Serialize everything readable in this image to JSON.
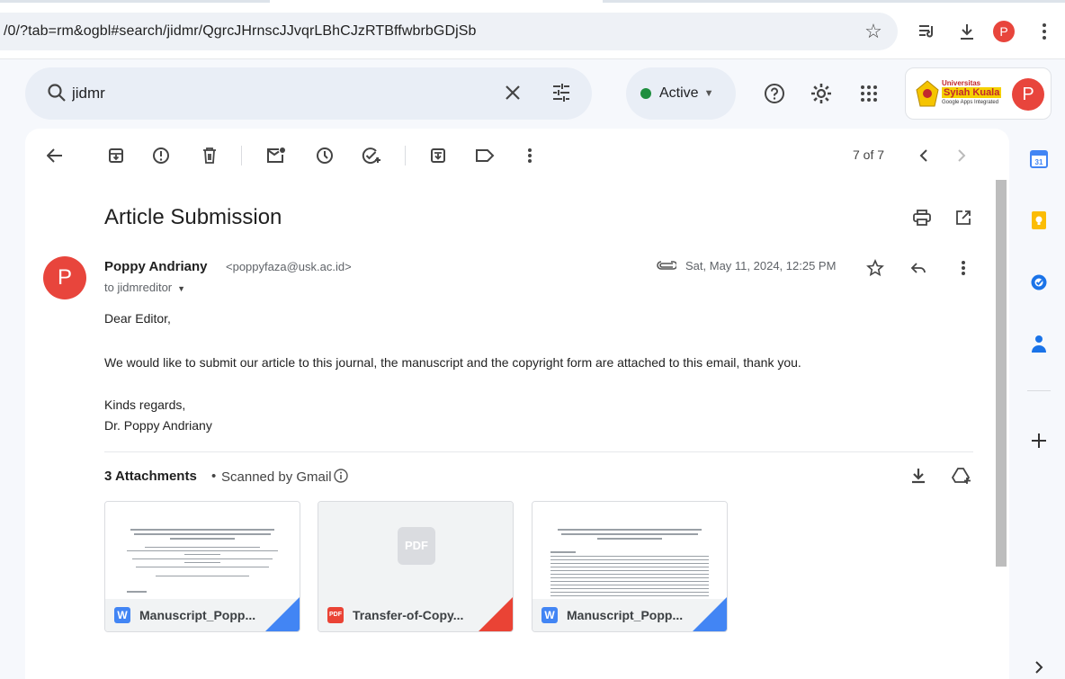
{
  "browser": {
    "url": "/0/?tab=rm&ogbl#search/jidmr/QgrcJHrnscJJvqrLBhCJzRTBffwbrbGDjSb",
    "profile_initial": "P"
  },
  "header": {
    "search_value": "jidmr",
    "status_label": "Active",
    "org_line1": "Universitas",
    "org_line2": "Syiah Kuala",
    "org_line3": "Google Apps Integrated",
    "account_initial": "P"
  },
  "toolbar": {
    "pager": "7 of 7"
  },
  "email": {
    "subject": "Article Submission",
    "sender_initial": "P",
    "sender_name": "Poppy Andriany",
    "sender_email": "<poppyfaza@usk.ac.id>",
    "to": "to jidmreditor",
    "date": "Sat, May 11, 2024, 12:25 PM",
    "body": {
      "greeting": "Dear Editor,",
      "line1": "We would like to submit our article to this journal, the manuscript and the copyright form are attached to this email, thank you.",
      "closing": "Kinds regards,",
      "signature": "Dr. Poppy Andriany"
    }
  },
  "attachments": {
    "title": "3 Attachments",
    "scanned": "Scanned by Gmail",
    "items": [
      {
        "name": "Manuscript_Popp...",
        "badge": "W",
        "color": "#4285f4"
      },
      {
        "name": "Transfer-of-Copy...",
        "badge": "PDF",
        "color": "#ea4335",
        "preview_label": "PDF"
      },
      {
        "name": "Manuscript_Popp...",
        "badge": "W",
        "color": "#4285f4"
      }
    ]
  },
  "icons": {
    "calendar_day": "31"
  },
  "colors": {
    "accent_red": "#e8453c",
    "active_green": "#1e8e3e"
  }
}
